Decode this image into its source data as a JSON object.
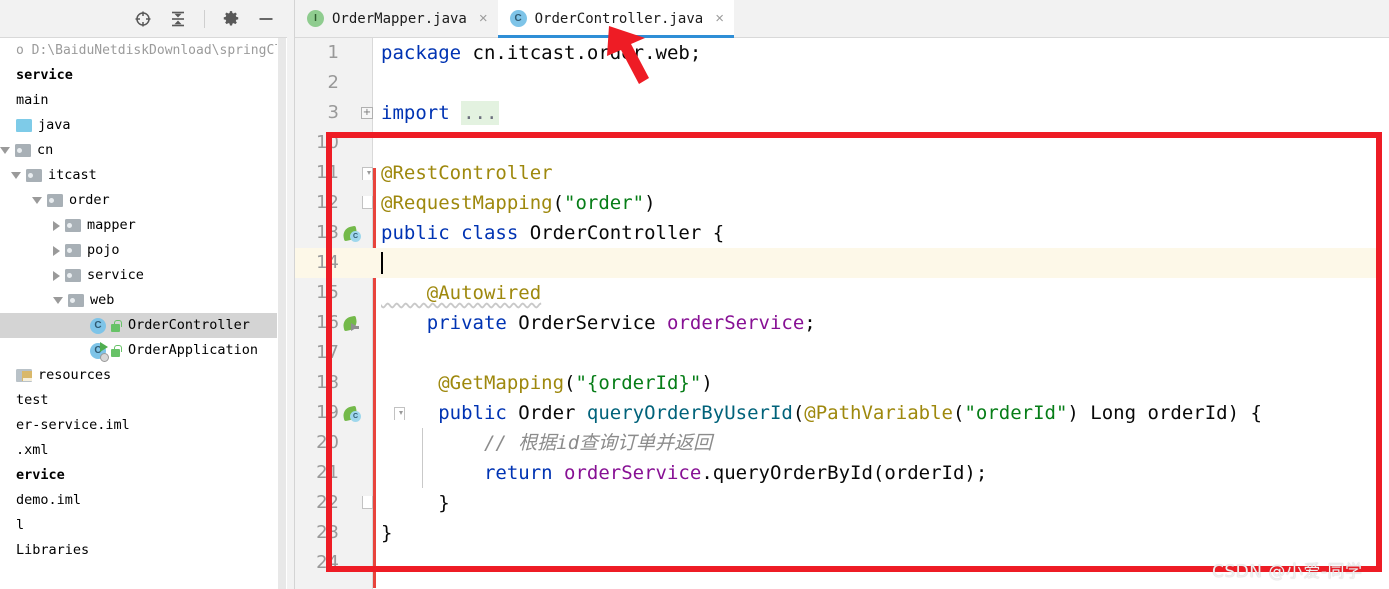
{
  "toolbar": {
    "icons": [
      {
        "name": "locate-target-icon",
        "glyph": "target"
      },
      {
        "name": "collapse-all-icon",
        "glyph": "collapse"
      },
      {
        "name": "settings-gear-icon",
        "glyph": "gear"
      },
      {
        "name": "minimize-icon",
        "glyph": "minus"
      }
    ]
  },
  "sidebar": {
    "tree": [
      {
        "label": "o  D:\\BaiduNetdiskDownload\\springClou",
        "kind": "path",
        "indent": 0,
        "arrow": "none",
        "icon": "none"
      },
      {
        "label": "service",
        "kind": "bold",
        "indent": 0,
        "arrow": "none",
        "icon": "none"
      },
      {
        "label": "main",
        "kind": "plain",
        "indent": 0,
        "arrow": "none",
        "icon": "none"
      },
      {
        "label": "java",
        "kind": "plain",
        "indent": 0,
        "arrow": "none",
        "icon": "folder-blue"
      },
      {
        "label": "cn",
        "kind": "plain",
        "indent": 0,
        "arrow": "down",
        "icon": "folder-grey"
      },
      {
        "label": "itcast",
        "kind": "plain",
        "indent": 1,
        "arrow": "down",
        "icon": "folder-grey"
      },
      {
        "label": "order",
        "kind": "plain",
        "indent": 2,
        "arrow": "down",
        "icon": "folder-grey"
      },
      {
        "label": "mapper",
        "kind": "plain",
        "indent": 3,
        "arrow": "right",
        "icon": "folder-grey"
      },
      {
        "label": "pojo",
        "kind": "plain",
        "indent": 3,
        "arrow": "right",
        "icon": "folder-grey"
      },
      {
        "label": "service",
        "kind": "plain",
        "indent": 3,
        "arrow": "right",
        "icon": "folder-grey"
      },
      {
        "label": "web",
        "kind": "plain",
        "indent": 3,
        "arrow": "down",
        "icon": "folder-grey"
      },
      {
        "label": "OrderController",
        "kind": "plain",
        "indent": 4,
        "arrow": "none",
        "icon": "class",
        "selected": true
      },
      {
        "label": "OrderApplication",
        "kind": "plain",
        "indent": 4,
        "arrow": "none",
        "icon": "class-run"
      },
      {
        "label": "resources",
        "kind": "plain",
        "indent": 0,
        "arrow": "none",
        "icon": "folder-res"
      },
      {
        "label": "test",
        "kind": "plain",
        "indent": 0,
        "arrow": "none",
        "icon": "none"
      },
      {
        "label": "er-service.iml",
        "kind": "plain",
        "indent": 0,
        "arrow": "none",
        "icon": "none"
      },
      {
        "label": ".xml",
        "kind": "plain",
        "indent": 0,
        "arrow": "none",
        "icon": "none"
      },
      {
        "label": "ervice",
        "kind": "bold",
        "indent": 0,
        "arrow": "none",
        "icon": "none"
      },
      {
        "label": "demo.iml",
        "kind": "plain",
        "indent": 0,
        "arrow": "none",
        "icon": "none"
      },
      {
        "label": "l",
        "kind": "plain",
        "indent": 0,
        "arrow": "none",
        "icon": "none"
      },
      {
        "label": "Libraries",
        "kind": "plain",
        "indent": 0,
        "arrow": "none",
        "icon": "none"
      }
    ]
  },
  "tabs": [
    {
      "label": "OrderMapper.java",
      "icon": "I",
      "icon_kind": "interface",
      "active": false,
      "close": "×"
    },
    {
      "label": "OrderController.java",
      "icon": "C",
      "icon_kind": "class",
      "active": true,
      "close": "×"
    }
  ],
  "editor": {
    "lines": [
      {
        "num": "1",
        "gutter": "none",
        "fold": "none",
        "segments": [
          {
            "t": "package ",
            "c": "kw"
          },
          {
            "t": "cn.itcast.order.web;",
            "c": "plain"
          }
        ]
      },
      {
        "num": "2",
        "gutter": "none",
        "fold": "none",
        "segments": []
      },
      {
        "num": "3",
        "gutter": "none",
        "fold": "plus",
        "segments": [
          {
            "t": "import ",
            "c": "kw"
          },
          {
            "t": "...",
            "c": "fold-hl"
          }
        ]
      },
      {
        "num": "10",
        "gutter": "none",
        "fold": "none",
        "segments": []
      },
      {
        "num": "11",
        "gutter": "none",
        "fold": "top",
        "segments": [
          {
            "t": "@RestController",
            "c": "ann"
          }
        ]
      },
      {
        "num": "12",
        "gutter": "none",
        "fold": "bot",
        "segments": [
          {
            "t": "@RequestMapping",
            "c": "ann"
          },
          {
            "t": "(",
            "c": "plain"
          },
          {
            "t": "\"order\"",
            "c": "str"
          },
          {
            "t": ")",
            "c": "plain"
          }
        ]
      },
      {
        "num": "13",
        "gutter": "bean-c",
        "fold": "none",
        "segments": [
          {
            "t": "public class ",
            "c": "kw"
          },
          {
            "t": "OrderController ",
            "c": "plain"
          },
          {
            "t": "{",
            "c": "plain"
          }
        ]
      },
      {
        "num": "14",
        "gutter": "none",
        "fold": "none",
        "current": true,
        "caret": true,
        "segments": []
      },
      {
        "num": "15",
        "gutter": "none",
        "fold": "none",
        "segments": [
          {
            "t": "    @Autowired",
            "c": "ann-wavy"
          }
        ]
      },
      {
        "num": "16",
        "gutter": "bean-arr",
        "fold": "none",
        "segments": [
          {
            "t": "    private ",
            "c": "kw"
          },
          {
            "t": "OrderService ",
            "c": "plain"
          },
          {
            "t": "orderService",
            "c": "purp"
          },
          {
            "t": ";",
            "c": "plain"
          }
        ]
      },
      {
        "num": "17",
        "gutter": "none",
        "fold": "none",
        "segments": []
      },
      {
        "num": "18",
        "gutter": "none",
        "fold": "none",
        "segments": [
          {
            "t": "     @GetMapping",
            "c": "ann"
          },
          {
            "t": "(",
            "c": "plain"
          },
          {
            "t": "\"{orderId}\"",
            "c": "str"
          },
          {
            "t": ")",
            "c": "plain"
          }
        ]
      },
      {
        "num": "19",
        "gutter": "bean-c",
        "fold": "bot2",
        "segments": [
          {
            "t": "     public ",
            "c": "kw"
          },
          {
            "t": "Order ",
            "c": "plain"
          },
          {
            "t": "queryOrderByUserId",
            "c": "kw-meth"
          },
          {
            "t": "(",
            "c": "plain"
          },
          {
            "t": "@PathVariable",
            "c": "ann"
          },
          {
            "t": "(",
            "c": "plain"
          },
          {
            "t": "\"orderId\"",
            "c": "str"
          },
          {
            "t": ") ",
            "c": "plain"
          },
          {
            "t": "Long ",
            "c": "plain"
          },
          {
            "t": "orderId",
            "c": "plain"
          },
          {
            "t": ") {",
            "c": "plain"
          }
        ]
      },
      {
        "num": "20",
        "gutter": "none",
        "fold": "bar",
        "segments": [
          {
            "t": "         // 根据id查询订单并返回",
            "c": "com"
          }
        ]
      },
      {
        "num": "21",
        "gutter": "none",
        "fold": "bar",
        "segments": [
          {
            "t": "         return ",
            "c": "kw"
          },
          {
            "t": "orderService",
            "c": "purp"
          },
          {
            "t": ".",
            "c": "plain"
          },
          {
            "t": "queryOrderById",
            "c": "plain"
          },
          {
            "t": "(orderId);",
            "c": "plain"
          }
        ]
      },
      {
        "num": "22",
        "gutter": "none",
        "fold": "bot",
        "segments": [
          {
            "t": "     }",
            "c": "plain"
          }
        ]
      },
      {
        "num": "23",
        "gutter": "none",
        "fold": "none",
        "segments": [
          {
            "t": "}",
            "c": "plain"
          }
        ]
      },
      {
        "num": "24",
        "gutter": "none",
        "fold": "none",
        "segments": []
      }
    ]
  },
  "annotations": {
    "rect_color": "#ee1c25",
    "arrow_color": "#ee1c25",
    "watermark": "CSDN @小爱-同学"
  }
}
